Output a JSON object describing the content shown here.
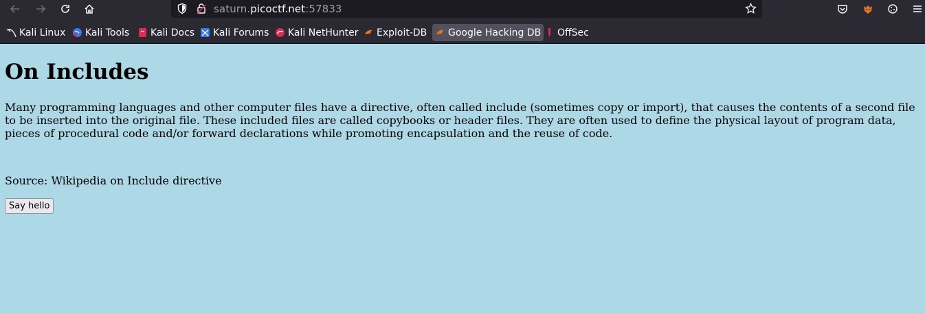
{
  "browser": {
    "url_host_prefix": "saturn.",
    "url_host_domain": "picoctf.net",
    "url_port": ":57833",
    "icons": {
      "back": "arrow-left-icon",
      "forward": "arrow-right-icon",
      "reload": "reload-icon",
      "home": "home-icon",
      "shield": "shield-icon",
      "lock": "lock-icon",
      "star": "star-icon",
      "pocket": "pocket-icon",
      "extension": "fox-extension-icon",
      "cookie": "cookie-icon",
      "menu": "hamburger-menu-icon"
    },
    "colors": {
      "toolbar_bg": "#2b2a33",
      "urlbar_bg": "#1c1b22",
      "active_bookmark_bg": "#52525e"
    }
  },
  "bookmarks": [
    {
      "label": "Kali Linux",
      "icon": "kali-dragon-icon"
    },
    {
      "label": "Kali Tools",
      "icon": "kali-tools-icon"
    },
    {
      "label": "Kali Docs",
      "icon": "kali-docs-icon"
    },
    {
      "label": "Kali Forums",
      "icon": "kali-forums-icon"
    },
    {
      "label": "Kali NetHunter",
      "icon": "nethunter-icon"
    },
    {
      "label": "Exploit-DB",
      "icon": "exploit-db-icon"
    },
    {
      "label": "Google Hacking DB",
      "icon": "ghdb-icon"
    },
    {
      "label": "OffSec",
      "icon": "offsec-icon"
    }
  ],
  "page": {
    "background": "#add8e6",
    "title": "On Includes",
    "paragraph": "Many programming languages and other computer files have a directive, often called include (sometimes copy or import), that causes the contents of a second file to be inserted into the original file. These included files are called copybooks or header files. They are often used to define the physical layout of program data, pieces of procedural code and/or forward declarations while promoting encapsulation and the reuse of code.",
    "source": "Source: Wikipedia on Include directive",
    "button_label": "Say hello"
  }
}
